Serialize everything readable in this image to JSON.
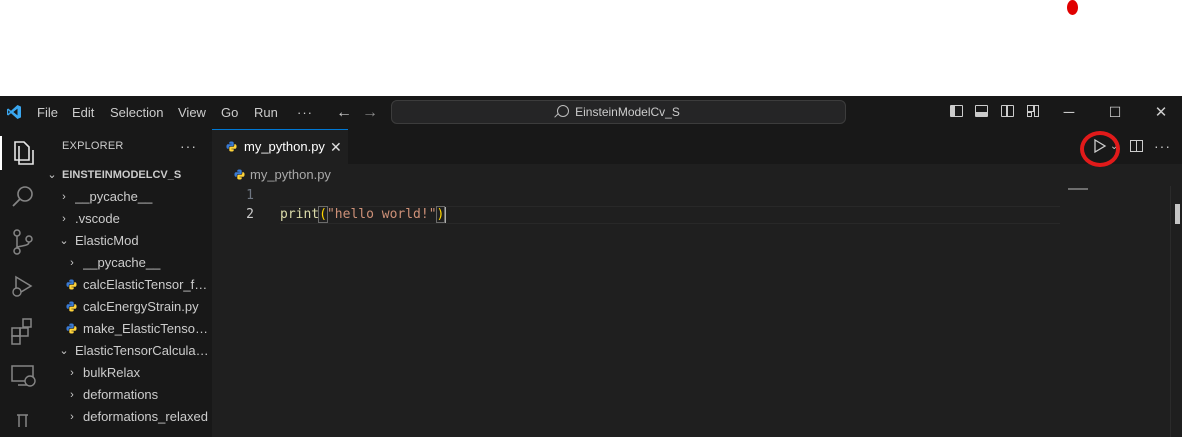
{
  "window": {
    "menu": [
      "File",
      "Edit",
      "Selection",
      "View",
      "Go",
      "Run"
    ],
    "menu_overflow": "···",
    "search": {
      "text": "EinsteinModelCv_S"
    },
    "controls": {
      "minimize": "─",
      "maximize": "☐",
      "close": "✕"
    }
  },
  "sidebar": {
    "title": "EXPLORER",
    "more": "···",
    "root": "EINSTEINMODELCV_S",
    "items": [
      {
        "label": "__pycache__",
        "kind": "folder",
        "expanded": false
      },
      {
        "label": ".vscode",
        "kind": "folder",
        "expanded": false
      },
      {
        "label": "ElasticMod",
        "kind": "folder",
        "expanded": true
      },
      {
        "label": "__pycache__",
        "kind": "folder",
        "expanded": false
      },
      {
        "label": "calcElasticTensor_fro...",
        "kind": "python"
      },
      {
        "label": "calcEnergyStrain.py",
        "kind": "python"
      },
      {
        "label": "make_ElasticTensor_i...",
        "kind": "python"
      },
      {
        "label": "ElasticTensorCalculati...",
        "kind": "folder",
        "expanded": true
      },
      {
        "label": "bulkRelax",
        "kind": "folder",
        "expanded": false
      },
      {
        "label": "deformations",
        "kind": "folder",
        "expanded": false
      },
      {
        "label": "deformations_relaxed",
        "kind": "folder",
        "expanded": false
      }
    ]
  },
  "editor": {
    "tab": {
      "label": "my_python.py",
      "close": "✕"
    },
    "breadcrumb": "my_python.py",
    "line_numbers": [
      "1",
      "2"
    ],
    "code": {
      "fn": "print",
      "open_paren": "(",
      "string": "\"hello world!\"",
      "close_paren": ")"
    },
    "toolbar": {
      "run_dropdown": "⌄",
      "more": "···"
    }
  },
  "colors": {
    "accent": "#0078d4",
    "annotation_red": "#e11a1a",
    "python_blue": "#3a7bd5",
    "python_yellow": "#ffd43b"
  }
}
